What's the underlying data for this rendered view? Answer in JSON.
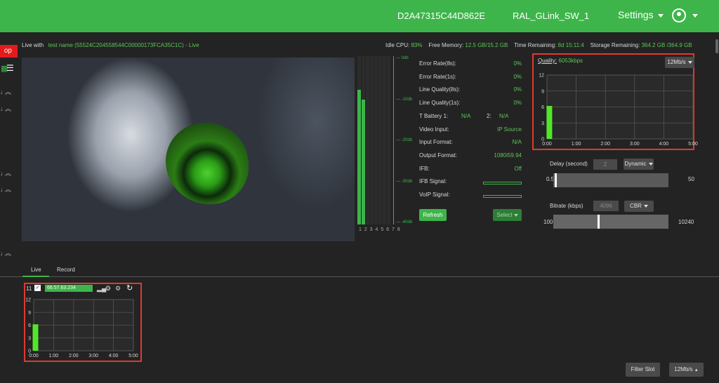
{
  "topbar": {
    "device_id": "D2A47315C44D862E",
    "device_name": "RAL_GLink_SW_1",
    "settings_label": "Settings"
  },
  "sidebar": {
    "stop_label": "op"
  },
  "info": {
    "live_with_label": "Live with",
    "live_with_value": "test name (55524C204558544C00000173FCA35C1C) - Live",
    "idle_cpu_label": "Idle CPU:",
    "idle_cpu": "83%",
    "free_memory_label": "Free Memory:",
    "free_memory": "12.5 GB/15.2 GB",
    "time_remaining_label": "Time Remaining:",
    "time_remaining": "8d 15:11:4",
    "storage_remaining_label": "Storage Remaining:",
    "storage_remaining": "364.2 GB /364.9 GB"
  },
  "meters": {
    "channels": "1 2 3 4 5 6 7 8",
    "scale": [
      "0db",
      "-10db",
      "-20db",
      "-30db",
      "-40db"
    ],
    "levels": [
      0.8,
      0.74,
      0,
      0,
      0,
      0,
      0,
      0
    ]
  },
  "stats": [
    {
      "label": "Error Rate(8s):",
      "value": "0%"
    },
    {
      "label": "Error Rate(1s):",
      "value": "0%"
    },
    {
      "label": "Line Quality(8s):",
      "value": "0%"
    },
    {
      "label": "Line Quality(1s):",
      "value": "0%"
    },
    {
      "label": "T Battery 1:",
      "value": ""
    },
    {
      "label": "Video Input:",
      "value": "IP Source"
    },
    {
      "label": "Input Format:",
      "value": "N/A"
    },
    {
      "label": "Output Format:",
      "value": "1080i59.94"
    },
    {
      "label": "IFB:",
      "value": "Off"
    },
    {
      "label": "IFB Signal:",
      "value": ""
    },
    {
      "label": "VoIP Signal:",
      "value": ""
    }
  ],
  "battery": {
    "b1": "N/A",
    "b2_label": "2:",
    "b2": "N/A"
  },
  "buttons": {
    "refresh": "Refresh",
    "select": "Select"
  },
  "quality": {
    "label": "Quality:",
    "value": "6053kbps",
    "rate_select": "12Mb/s"
  },
  "delay": {
    "label": "Delay (second)",
    "value": "2",
    "mode": "Dynamic",
    "min": "0.5",
    "max": "50",
    "position": 0.01
  },
  "bitrate": {
    "label": "Bitrate (kbps)",
    "value": "4096",
    "mode": "CBR",
    "min": "100",
    "max": "10240",
    "position": 0.39
  },
  "tabs": {
    "live": "Live",
    "record": "Record"
  },
  "modem": {
    "index": "11",
    "ip": "66.57.63.234"
  },
  "footer": {
    "filter_slot": "Filter Slot",
    "rate_select": "12Mb/s"
  },
  "chart_data": [
    {
      "type": "bar",
      "x_ticks": [
        "0:00",
        "1:00",
        "2:00",
        "3:00",
        "4:00",
        "5:00"
      ],
      "y_ticks": [
        "12",
        "9",
        "6",
        "3",
        "0"
      ],
      "ylim": [
        0,
        12
      ],
      "xlim": [
        0,
        5
      ],
      "series": [
        {
          "x": [
            0.07
          ],
          "values": [
            6.2
          ]
        }
      ],
      "grid": true
    },
    {
      "type": "bar",
      "x_ticks": [
        "0:00",
        "1:00",
        "2:00",
        "3:00",
        "4:00",
        "5:00"
      ],
      "y_ticks": [
        "12",
        "9",
        "6",
        "3",
        "0"
      ],
      "ylim": [
        0,
        12
      ],
      "xlim": [
        0,
        5
      ],
      "series": [
        {
          "x": [
            0.07
          ],
          "values": [
            6.2
          ]
        }
      ],
      "grid": true
    }
  ]
}
